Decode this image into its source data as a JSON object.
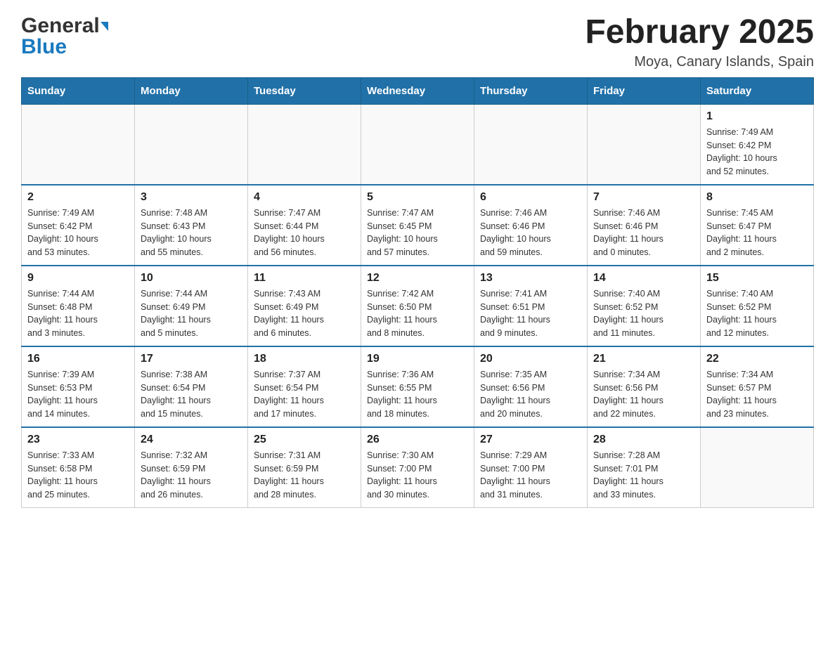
{
  "header": {
    "logo_general": "General",
    "logo_blue": "Blue",
    "month_title": "February 2025",
    "location": "Moya, Canary Islands, Spain"
  },
  "days_of_week": [
    "Sunday",
    "Monday",
    "Tuesday",
    "Wednesday",
    "Thursday",
    "Friday",
    "Saturday"
  ],
  "weeks": [
    [
      {
        "day": "",
        "info": ""
      },
      {
        "day": "",
        "info": ""
      },
      {
        "day": "",
        "info": ""
      },
      {
        "day": "",
        "info": ""
      },
      {
        "day": "",
        "info": ""
      },
      {
        "day": "",
        "info": ""
      },
      {
        "day": "1",
        "info": "Sunrise: 7:49 AM\nSunset: 6:42 PM\nDaylight: 10 hours\nand 52 minutes."
      }
    ],
    [
      {
        "day": "2",
        "info": "Sunrise: 7:49 AM\nSunset: 6:42 PM\nDaylight: 10 hours\nand 53 minutes."
      },
      {
        "day": "3",
        "info": "Sunrise: 7:48 AM\nSunset: 6:43 PM\nDaylight: 10 hours\nand 55 minutes."
      },
      {
        "day": "4",
        "info": "Sunrise: 7:47 AM\nSunset: 6:44 PM\nDaylight: 10 hours\nand 56 minutes."
      },
      {
        "day": "5",
        "info": "Sunrise: 7:47 AM\nSunset: 6:45 PM\nDaylight: 10 hours\nand 57 minutes."
      },
      {
        "day": "6",
        "info": "Sunrise: 7:46 AM\nSunset: 6:46 PM\nDaylight: 10 hours\nand 59 minutes."
      },
      {
        "day": "7",
        "info": "Sunrise: 7:46 AM\nSunset: 6:46 PM\nDaylight: 11 hours\nand 0 minutes."
      },
      {
        "day": "8",
        "info": "Sunrise: 7:45 AM\nSunset: 6:47 PM\nDaylight: 11 hours\nand 2 minutes."
      }
    ],
    [
      {
        "day": "9",
        "info": "Sunrise: 7:44 AM\nSunset: 6:48 PM\nDaylight: 11 hours\nand 3 minutes."
      },
      {
        "day": "10",
        "info": "Sunrise: 7:44 AM\nSunset: 6:49 PM\nDaylight: 11 hours\nand 5 minutes."
      },
      {
        "day": "11",
        "info": "Sunrise: 7:43 AM\nSunset: 6:49 PM\nDaylight: 11 hours\nand 6 minutes."
      },
      {
        "day": "12",
        "info": "Sunrise: 7:42 AM\nSunset: 6:50 PM\nDaylight: 11 hours\nand 8 minutes."
      },
      {
        "day": "13",
        "info": "Sunrise: 7:41 AM\nSunset: 6:51 PM\nDaylight: 11 hours\nand 9 minutes."
      },
      {
        "day": "14",
        "info": "Sunrise: 7:40 AM\nSunset: 6:52 PM\nDaylight: 11 hours\nand 11 minutes."
      },
      {
        "day": "15",
        "info": "Sunrise: 7:40 AM\nSunset: 6:52 PM\nDaylight: 11 hours\nand 12 minutes."
      }
    ],
    [
      {
        "day": "16",
        "info": "Sunrise: 7:39 AM\nSunset: 6:53 PM\nDaylight: 11 hours\nand 14 minutes."
      },
      {
        "day": "17",
        "info": "Sunrise: 7:38 AM\nSunset: 6:54 PM\nDaylight: 11 hours\nand 15 minutes."
      },
      {
        "day": "18",
        "info": "Sunrise: 7:37 AM\nSunset: 6:54 PM\nDaylight: 11 hours\nand 17 minutes."
      },
      {
        "day": "19",
        "info": "Sunrise: 7:36 AM\nSunset: 6:55 PM\nDaylight: 11 hours\nand 18 minutes."
      },
      {
        "day": "20",
        "info": "Sunrise: 7:35 AM\nSunset: 6:56 PM\nDaylight: 11 hours\nand 20 minutes."
      },
      {
        "day": "21",
        "info": "Sunrise: 7:34 AM\nSunset: 6:56 PM\nDaylight: 11 hours\nand 22 minutes."
      },
      {
        "day": "22",
        "info": "Sunrise: 7:34 AM\nSunset: 6:57 PM\nDaylight: 11 hours\nand 23 minutes."
      }
    ],
    [
      {
        "day": "23",
        "info": "Sunrise: 7:33 AM\nSunset: 6:58 PM\nDaylight: 11 hours\nand 25 minutes."
      },
      {
        "day": "24",
        "info": "Sunrise: 7:32 AM\nSunset: 6:59 PM\nDaylight: 11 hours\nand 26 minutes."
      },
      {
        "day": "25",
        "info": "Sunrise: 7:31 AM\nSunset: 6:59 PM\nDaylight: 11 hours\nand 28 minutes."
      },
      {
        "day": "26",
        "info": "Sunrise: 7:30 AM\nSunset: 7:00 PM\nDaylight: 11 hours\nand 30 minutes."
      },
      {
        "day": "27",
        "info": "Sunrise: 7:29 AM\nSunset: 7:00 PM\nDaylight: 11 hours\nand 31 minutes."
      },
      {
        "day": "28",
        "info": "Sunrise: 7:28 AM\nSunset: 7:01 PM\nDaylight: 11 hours\nand 33 minutes."
      },
      {
        "day": "",
        "info": ""
      }
    ]
  ]
}
